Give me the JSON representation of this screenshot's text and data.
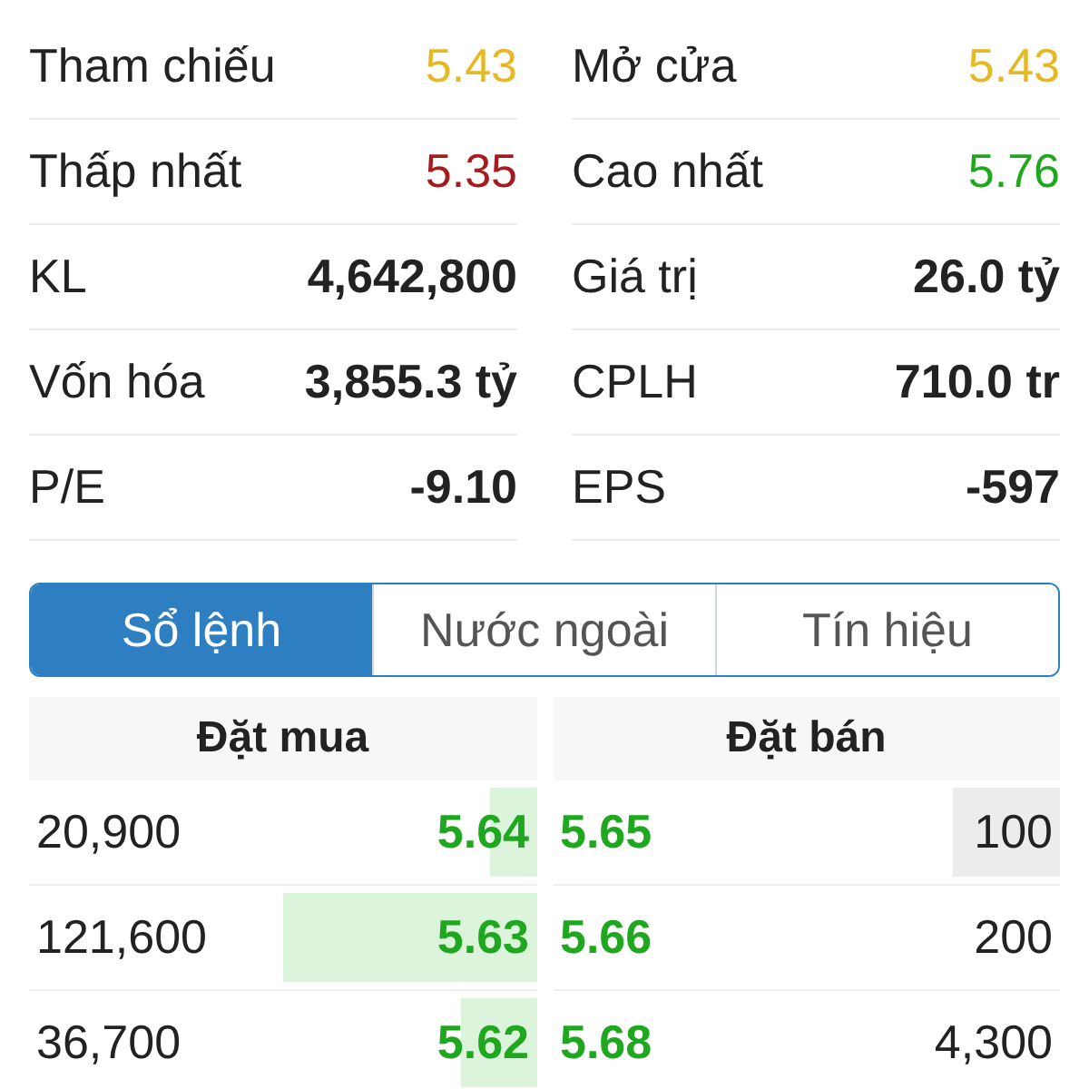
{
  "stats": [
    {
      "label": "Tham chiếu",
      "value": "5.43",
      "color": "#e6b824",
      "bold": false
    },
    {
      "label": "Mở cửa",
      "value": "5.43",
      "color": "#e6b824",
      "bold": false
    },
    {
      "label": "Thấp nhất",
      "value": "5.35",
      "color": "#a51c1c",
      "bold": false
    },
    {
      "label": "Cao nhất",
      "value": "5.76",
      "color": "#1fa81f",
      "bold": false
    },
    {
      "label": "KL",
      "value": "4,642,800",
      "color": "#222222",
      "bold": true
    },
    {
      "label": "Giá trị",
      "value": "26.0 tỷ",
      "color": "#222222",
      "bold": true
    },
    {
      "label": "Vốn hóa",
      "value": "3,855.3 tỷ",
      "color": "#222222",
      "bold": true
    },
    {
      "label": "CPLH",
      "value": "710.0 tr",
      "color": "#222222",
      "bold": true
    },
    {
      "label": "P/E",
      "value": "-9.10",
      "color": "#222222",
      "bold": true
    },
    {
      "label": "EPS",
      "value": "-597",
      "color": "#222222",
      "bold": true
    }
  ],
  "tabs": [
    {
      "label": "Sổ lệnh",
      "selected": true
    },
    {
      "label": "Nước ngoài",
      "selected": false
    },
    {
      "label": "Tín hiệu",
      "selected": false
    }
  ],
  "order_book": {
    "bid_title": "Đặt mua",
    "ask_title": "Đặt bán",
    "rows": [
      {
        "bid": {
          "volume": "20,900",
          "price": "5.64",
          "level": 0.09
        },
        "ask": {
          "price": "5.65",
          "volume": "100",
          "level": 0.21
        }
      },
      {
        "bid": {
          "volume": "121,600",
          "price": "5.63",
          "level": 0.5
        },
        "ask": {
          "price": "5.66",
          "volume": "200"
        }
      },
      {
        "bid": {
          "volume": "36,700",
          "price": "5.62",
          "level": 0.15
        },
        "ask": {
          "price": "5.68",
          "volume": "4,300"
        }
      }
    ]
  }
}
